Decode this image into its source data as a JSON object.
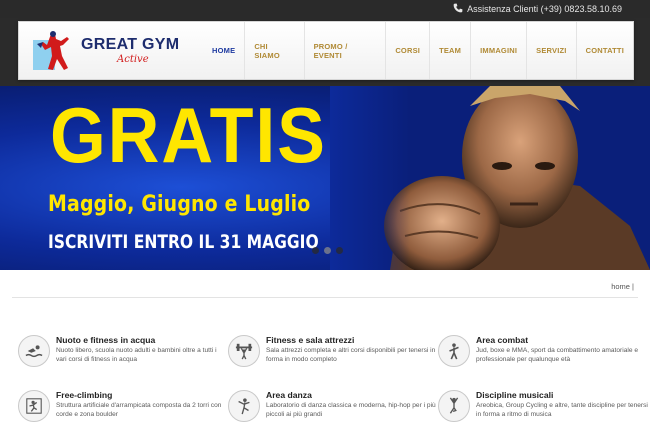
{
  "topbar": {
    "phone_icon": "phone-icon",
    "contact_text": "Assistenza Clienti (+39) 0823.58.10.69"
  },
  "header": {
    "logo_text": "GREAT GYM",
    "logo_subtext": "Active",
    "nav": [
      {
        "label": "HOME",
        "active": true
      },
      {
        "label": "CHI SIAMO",
        "active": false
      },
      {
        "label": "PROMO / EVENTI",
        "active": false
      },
      {
        "label": "CORSI",
        "active": false
      },
      {
        "label": "TEAM",
        "active": false
      },
      {
        "label": "IMMAGINI",
        "active": false
      },
      {
        "label": "SERVIZI",
        "active": false
      },
      {
        "label": "CONTATTI",
        "active": false
      }
    ]
  },
  "hero": {
    "title": "GRATIS",
    "subtitle": "Maggio, Giugno e Luglio",
    "note": "ISCRIVITI ENTRO IL 31 MAGGIO",
    "slide_count": 3,
    "active_slide": 1,
    "accent_color": "#ffe600",
    "background_color": "#0d2a9a"
  },
  "breadcrumb": {
    "text": "home |"
  },
  "services": [
    {
      "icon": "swimmer-icon",
      "title": "Nuoto e fitness in acqua",
      "desc": "Nuoto libero, scuola nuoto adulti e bambini oltre a tutti i vari corsi di fitness in acqua"
    },
    {
      "icon": "weightlifting-icon",
      "title": "Fitness e sala attrezzi",
      "desc": "Sala attrezzi completa e altri corsi disponibili per tenersi in forma in modo completo"
    },
    {
      "icon": "combat-icon",
      "title": "Area combat",
      "desc": "Jud, boxe e MMA, sport da combattimento amatoriale e professionale per qualunque età"
    },
    {
      "icon": "climbing-icon",
      "title": "Free-climbing",
      "desc": "Struttura artificiale d'arrampicata composta da 2 torri con corde e zona boulder"
    },
    {
      "icon": "dance-icon",
      "title": "Area danza",
      "desc": "Laboratorio di danza classica e moderna, hip-hop per i più piccoli ai più grandi"
    },
    {
      "icon": "yoga-icon",
      "title": "Discipline musicali",
      "desc": "Areobica, Group Cycling e altre, tante discipline per tenersi in forma a ritmo di musica"
    }
  ]
}
